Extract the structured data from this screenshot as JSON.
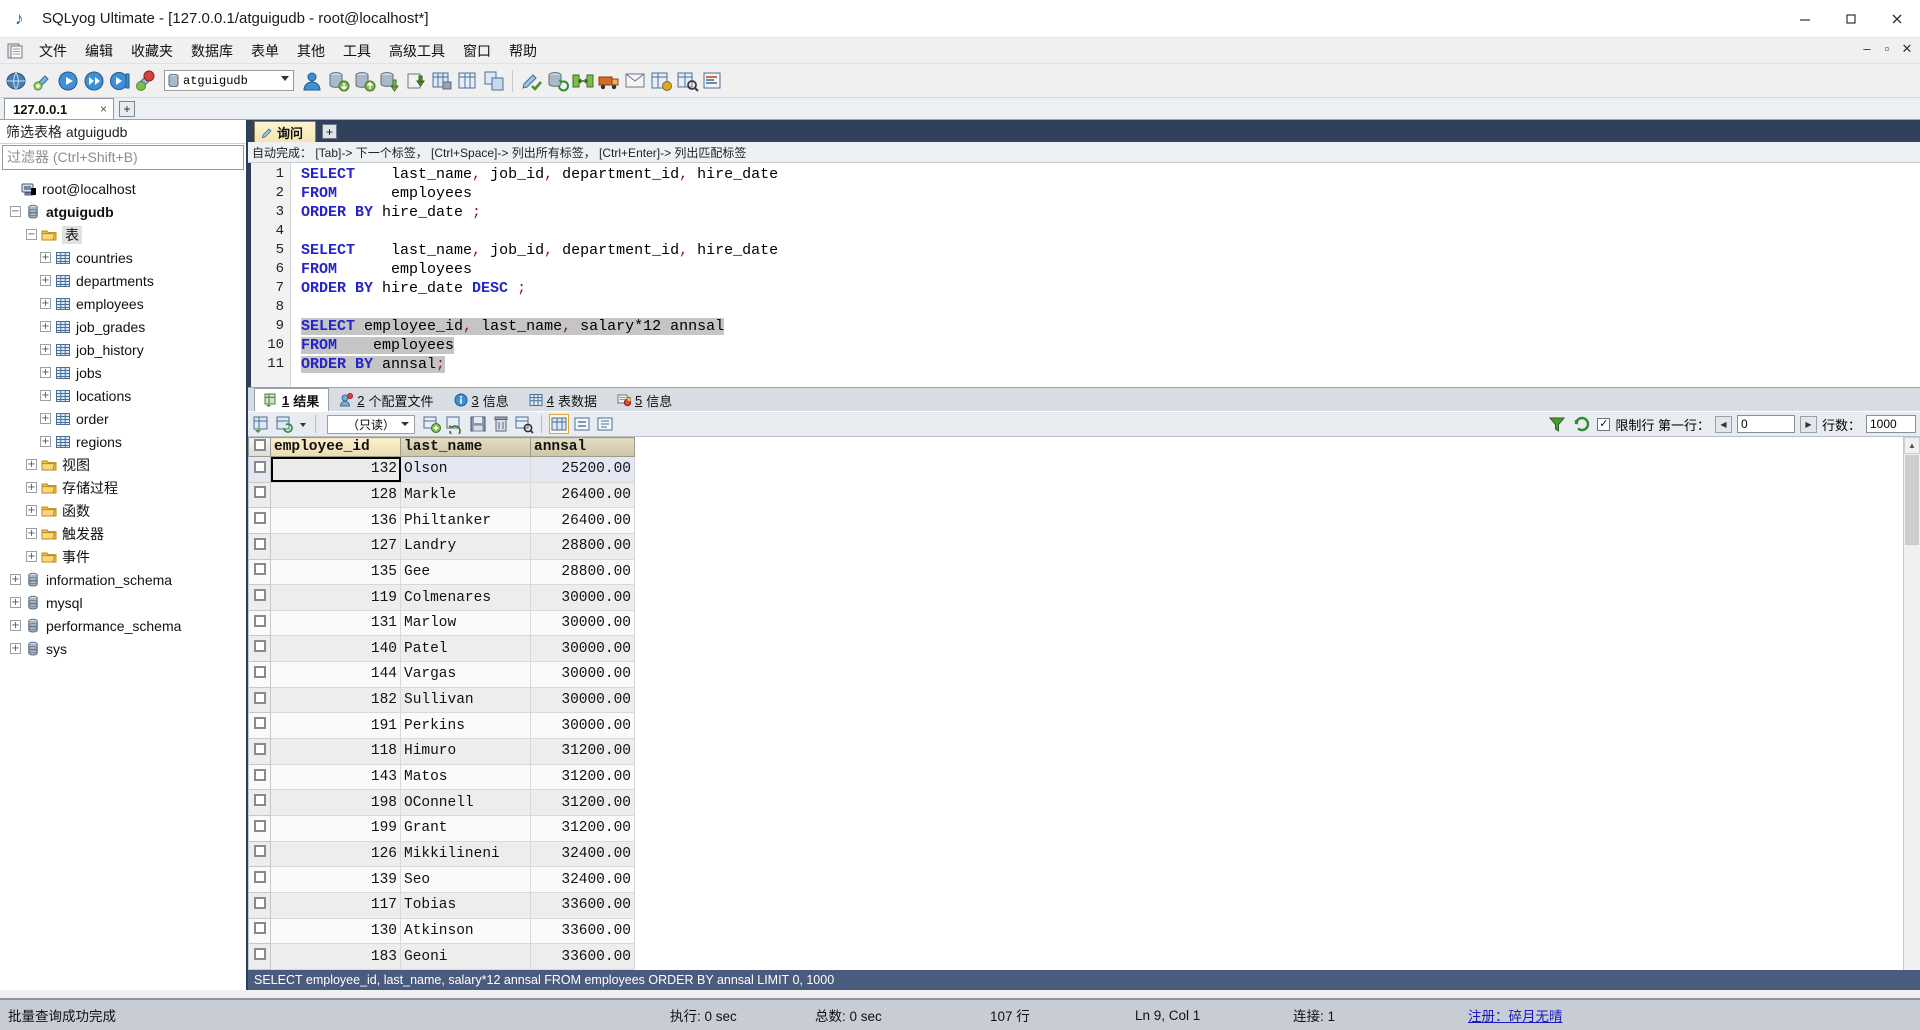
{
  "window": {
    "title": "SQLyog Ultimate - [127.0.0.1/atguigudb - root@localhost*]",
    "minimize": "–",
    "maximize": "▢",
    "close": "✕"
  },
  "menubar": {
    "items": [
      {
        "label": "文件",
        "name": "menu-file"
      },
      {
        "label": "编辑",
        "name": "menu-edit"
      },
      {
        "label": "收藏夹",
        "name": "menu-favorites"
      },
      {
        "label": "数据库",
        "name": "menu-database"
      },
      {
        "label": "表单",
        "name": "menu-table"
      },
      {
        "label": "其他",
        "name": "menu-other"
      },
      {
        "label": "工具",
        "name": "menu-tools"
      },
      {
        "label": "高级工具",
        "name": "menu-powertools"
      },
      {
        "label": "窗口",
        "name": "menu-window"
      },
      {
        "label": "帮助",
        "name": "menu-help"
      }
    ],
    "mdi_minimize": "–",
    "mdi_restore": "▫",
    "mdi_close": "✕"
  },
  "toolbar": {
    "database_combo_value": "atguigudb"
  },
  "connection_tabs": {
    "tabs": [
      {
        "label": "127.0.0.1",
        "close": "×"
      }
    ],
    "add_label": "+"
  },
  "sidebar": {
    "filter_label": "筛选表格 atguigudb",
    "filter_placeholder": "过滤器 (Ctrl+Shift+B)",
    "tree": [
      {
        "label": "root@localhost",
        "level": 0,
        "icon": "server-icon",
        "expander": "",
        "bold": false
      },
      {
        "label": "atguigudb",
        "level": 1,
        "icon": "database-icon",
        "expander": "−",
        "bold": true
      },
      {
        "label": "表",
        "level": 2,
        "icon": "folder-icon",
        "expander": "−",
        "bold": false,
        "selected": true
      },
      {
        "label": "countries",
        "level": 3,
        "icon": "table-icon",
        "expander": "+",
        "bold": false
      },
      {
        "label": "departments",
        "level": 3,
        "icon": "table-icon",
        "expander": "+",
        "bold": false
      },
      {
        "label": "employees",
        "level": 3,
        "icon": "table-icon",
        "expander": "+",
        "bold": false
      },
      {
        "label": "job_grades",
        "level": 3,
        "icon": "table-icon",
        "expander": "+",
        "bold": false
      },
      {
        "label": "job_history",
        "level": 3,
        "icon": "table-icon",
        "expander": "+",
        "bold": false
      },
      {
        "label": "jobs",
        "level": 3,
        "icon": "table-icon",
        "expander": "+",
        "bold": false
      },
      {
        "label": "locations",
        "level": 3,
        "icon": "table-icon",
        "expander": "+",
        "bold": false
      },
      {
        "label": "order",
        "level": 3,
        "icon": "table-icon",
        "expander": "+",
        "bold": false
      },
      {
        "label": "regions",
        "level": 3,
        "icon": "table-icon",
        "expander": "+",
        "bold": false
      },
      {
        "label": "视图",
        "level": 2,
        "icon": "folder-icon",
        "expander": "+",
        "bold": false
      },
      {
        "label": "存储过程",
        "level": 2,
        "icon": "folder-icon",
        "expander": "+",
        "bold": false
      },
      {
        "label": "函数",
        "level": 2,
        "icon": "folder-icon",
        "expander": "+",
        "bold": false
      },
      {
        "label": "触发器",
        "level": 2,
        "icon": "folder-icon",
        "expander": "+",
        "bold": false
      },
      {
        "label": "事件",
        "level": 2,
        "icon": "folder-icon",
        "expander": "+",
        "bold": false
      },
      {
        "label": "information_schema",
        "level": 1,
        "icon": "database-icon",
        "expander": "+",
        "bold": false
      },
      {
        "label": "mysql",
        "level": 1,
        "icon": "database-icon",
        "expander": "+",
        "bold": false
      },
      {
        "label": "performance_schema",
        "level": 1,
        "icon": "database-icon",
        "expander": "+",
        "bold": false
      },
      {
        "label": "sys",
        "level": 1,
        "icon": "database-icon",
        "expander": "+",
        "bold": false
      }
    ]
  },
  "query_tabs": {
    "tabs": [
      {
        "label": "询问"
      }
    ],
    "add_label": "+"
  },
  "editor": {
    "hint": "自动完成： [Tab]-> 下一个标签， [Ctrl+Space]-> 列出所有标签， [Ctrl+Enter]-> 列出匹配标签",
    "line_numbers": [
      "1",
      "2",
      "3",
      "4",
      "5",
      "6",
      "7",
      "8",
      "9",
      "10",
      "11"
    ],
    "lines": [
      {
        "n": 1,
        "tokens": [
          {
            "t": "SELECT",
            "c": "kw"
          },
          {
            "t": "    last_name",
            "c": ""
          },
          {
            "t": ",",
            "c": "pn"
          },
          {
            "t": " job_id",
            "c": ""
          },
          {
            "t": ",",
            "c": "pn"
          },
          {
            "t": " department_id",
            "c": ""
          },
          {
            "t": ",",
            "c": "pn"
          },
          {
            "t": " hire_date",
            "c": ""
          }
        ],
        "hl": false
      },
      {
        "n": 2,
        "tokens": [
          {
            "t": "FROM",
            "c": "kw"
          },
          {
            "t": "      employees",
            "c": ""
          }
        ],
        "hl": false
      },
      {
        "n": 3,
        "tokens": [
          {
            "t": "ORDER BY",
            "c": "kw"
          },
          {
            "t": " hire_date ",
            "c": ""
          },
          {
            "t": ";",
            "c": "pn"
          }
        ],
        "hl": false
      },
      {
        "n": 4,
        "tokens": [],
        "hl": false
      },
      {
        "n": 5,
        "tokens": [
          {
            "t": "SELECT",
            "c": "kw"
          },
          {
            "t": "    last_name",
            "c": ""
          },
          {
            "t": ",",
            "c": "pn"
          },
          {
            "t": " job_id",
            "c": ""
          },
          {
            "t": ",",
            "c": "pn"
          },
          {
            "t": " department_id",
            "c": ""
          },
          {
            "t": ",",
            "c": "pn"
          },
          {
            "t": " hire_date",
            "c": ""
          }
        ],
        "hl": false
      },
      {
        "n": 6,
        "tokens": [
          {
            "t": "FROM",
            "c": "kw"
          },
          {
            "t": "      employees",
            "c": ""
          }
        ],
        "hl": false
      },
      {
        "n": 7,
        "tokens": [
          {
            "t": "ORDER BY",
            "c": "kw"
          },
          {
            "t": " hire_date ",
            "c": ""
          },
          {
            "t": "DESC",
            "c": "kw"
          },
          {
            "t": " ;",
            "c": "pn"
          }
        ],
        "hl": false
      },
      {
        "n": 8,
        "tokens": [],
        "hl": false
      },
      {
        "n": 9,
        "tokens": [
          {
            "t": "SELECT",
            "c": "kw"
          },
          {
            "t": " employee_id",
            "c": ""
          },
          {
            "t": ",",
            "c": "pn"
          },
          {
            "t": " last_name",
            "c": ""
          },
          {
            "t": ",",
            "c": "pn"
          },
          {
            "t": " salary*12 annsal",
            "c": ""
          }
        ],
        "hl": true
      },
      {
        "n": 10,
        "tokens": [
          {
            "t": "FROM",
            "c": "kw"
          },
          {
            "t": "    employees",
            "c": ""
          }
        ],
        "hl": true
      },
      {
        "n": 11,
        "tokens": [
          {
            "t": "ORDER BY",
            "c": "kw"
          },
          {
            "t": " annsal",
            "c": ""
          },
          {
            "t": ";",
            "c": "pn"
          }
        ],
        "hl": true
      }
    ]
  },
  "result_tabs": [
    {
      "num": "1",
      "label": "结果",
      "icon": "result-grid-icon",
      "active": true
    },
    {
      "num": "2",
      "label": "个配置文件",
      "icon": "profile-icon",
      "active": false
    },
    {
      "num": "3",
      "label": "信息",
      "icon": "info-icon",
      "active": false
    },
    {
      "num": "4",
      "label": "表数据",
      "icon": "table-data-icon",
      "active": false
    },
    {
      "num": "5",
      "label": "信息",
      "icon": "messages-icon",
      "active": false
    }
  ],
  "grid_toolbar": {
    "readonly_label": "（只读）",
    "limit_label": "限制行 第一行：",
    "limit_checked": true,
    "offset_value": "0",
    "rows_label": "行数：",
    "rows_value": "1000",
    "prev_arrow": "◀",
    "next_arrow": "▶"
  },
  "result_grid": {
    "columns": [
      "employee_id",
      "last_name",
      "annsal"
    ],
    "rows": [
      {
        "employee_id": "132",
        "last_name": "Olson",
        "annsal": "25200.00"
      },
      {
        "employee_id": "128",
        "last_name": "Markle",
        "annsal": "26400.00"
      },
      {
        "employee_id": "136",
        "last_name": "Philtanker",
        "annsal": "26400.00"
      },
      {
        "employee_id": "127",
        "last_name": "Landry",
        "annsal": "28800.00"
      },
      {
        "employee_id": "135",
        "last_name": "Gee",
        "annsal": "28800.00"
      },
      {
        "employee_id": "119",
        "last_name": "Colmenares",
        "annsal": "30000.00"
      },
      {
        "employee_id": "131",
        "last_name": "Marlow",
        "annsal": "30000.00"
      },
      {
        "employee_id": "140",
        "last_name": "Patel",
        "annsal": "30000.00"
      },
      {
        "employee_id": "144",
        "last_name": "Vargas",
        "annsal": "30000.00"
      },
      {
        "employee_id": "182",
        "last_name": "Sullivan",
        "annsal": "30000.00"
      },
      {
        "employee_id": "191",
        "last_name": "Perkins",
        "annsal": "30000.00"
      },
      {
        "employee_id": "118",
        "last_name": "Himuro",
        "annsal": "31200.00"
      },
      {
        "employee_id": "143",
        "last_name": "Matos",
        "annsal": "31200.00"
      },
      {
        "employee_id": "198",
        "last_name": "OConnell",
        "annsal": "31200.00"
      },
      {
        "employee_id": "199",
        "last_name": "Grant",
        "annsal": "31200.00"
      },
      {
        "employee_id": "126",
        "last_name": "Mikkilineni",
        "annsal": "32400.00"
      },
      {
        "employee_id": "139",
        "last_name": "Seo",
        "annsal": "32400.00"
      },
      {
        "employee_id": "117",
        "last_name": "Tobias",
        "annsal": "33600.00"
      },
      {
        "employee_id": "130",
        "last_name": "Atkinson",
        "annsal": "33600.00"
      },
      {
        "employee_id": "183",
        "last_name": "Geoni",
        "annsal": "33600.00"
      }
    ]
  },
  "sql_status_bar": "SELECT employee_id, last_name, salary*12 annsal FROM employees ORDER BY annsal LIMIT 0, 1000",
  "statusbar": {
    "message": "批量查询成功完成",
    "exec_time": "执行:  0 sec",
    "total_time": "总数:  0 sec",
    "row_count": "107 行",
    "cursor": "Ln 9, Col 1",
    "connections": "连接:  1",
    "register_label": "注册：",
    "register_user": "碎月无晴"
  },
  "colors": {
    "keyword": "#2424c8",
    "selection": "#c5c5c5",
    "tree_border": "#2c3e5b",
    "sql_status_bg": "#4a5c7d",
    "statusbar_bg": "#c8ccd4"
  }
}
